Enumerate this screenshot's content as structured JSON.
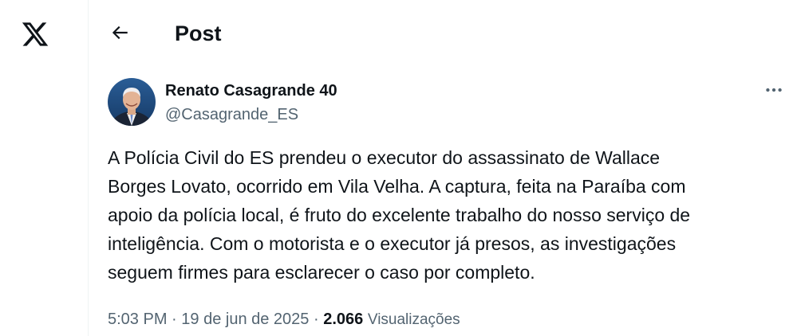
{
  "nav": {
    "logo_icon": "x-logo-icon"
  },
  "header": {
    "back_icon": "arrow-left-icon",
    "title": "Post"
  },
  "post": {
    "author_name": "Renato Casagrande 40",
    "author_handle": "@Casagrande_ES",
    "more_icon": "ellipsis-icon",
    "text_lines": [
      "A Polícia Civil do ES prendeu o executor do assassinato de Wallace",
      "Borges Lovato, ocorrido em Vila Velha. A captura, feita na Paraíba com",
      "apoio da polícia local, é fruto do excelente trabalho do nosso serviço de",
      "inteligência. Com o motorista e o executor já presos, as investigações",
      "seguem firmes para esclarecer o caso por completo."
    ],
    "time": "5:03 PM",
    "separator": "·",
    "date": "19 de jun de 2025",
    "views_count": "2.066",
    "views_label": "Visualizações"
  },
  "colors": {
    "text_primary": "#0f1419",
    "text_secondary": "#536471",
    "border": "#eff3f4"
  }
}
